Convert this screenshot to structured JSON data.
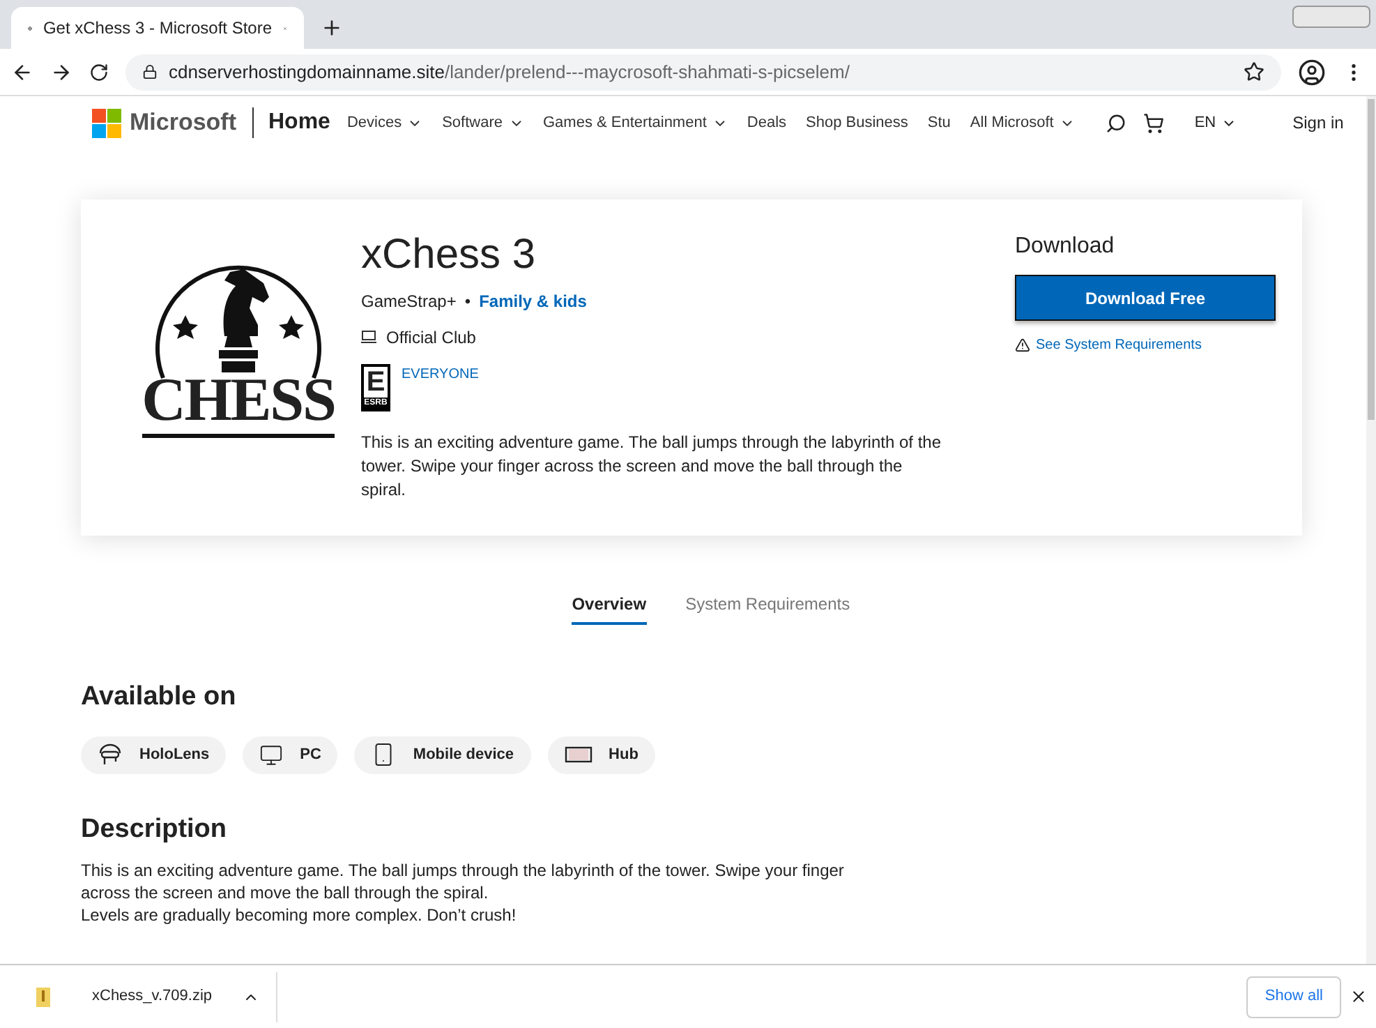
{
  "browser": {
    "tab_title": "Get xChess 3 - Microsoft Store",
    "url_host": "cdnserverhostingdomainname.site",
    "url_path": "/lander/prelend---maycrosoft-shahmati-s-picselem/"
  },
  "nav": {
    "brand": "Microsoft",
    "home": "Home",
    "items": [
      {
        "label": "Devices",
        "dropdown": true
      },
      {
        "label": "Software",
        "dropdown": true
      },
      {
        "label": "Games & Entertainment",
        "dropdown": true
      },
      {
        "label": "Deals",
        "dropdown": false
      },
      {
        "label": "Shop Business",
        "dropdown": false
      },
      {
        "label": "Stu",
        "dropdown": false
      },
      {
        "label": "All Microsoft",
        "dropdown": true
      }
    ],
    "language": "EN",
    "sign_in": "Sign in"
  },
  "product": {
    "logo_text": "CHESS",
    "title": "xChess 3",
    "publisher": "GameStrap+",
    "bullet": "•",
    "category": "Family & kids",
    "club": "Official Club",
    "rating_letter": "E",
    "rating_board": "ESRB",
    "rating": "EVERYONE",
    "summary": "This is an exciting adventure game. The ball jumps through the labyrinth of the tower. Swipe your finger across the screen and move the ball through the spiral."
  },
  "download": {
    "heading": "Download",
    "button": "Download Free",
    "requirements_link": "See System Requirements"
  },
  "tabs": [
    {
      "label": "Overview",
      "selected": true
    },
    {
      "label": "System Requirements",
      "selected": false
    }
  ],
  "available": {
    "heading": "Available on",
    "devices": [
      {
        "kind": "hololens",
        "label": "HoloLens"
      },
      {
        "kind": "pc",
        "label": "PC"
      },
      {
        "kind": "mobile",
        "label": "Mobile device"
      },
      {
        "kind": "hub",
        "label": "Hub"
      }
    ]
  },
  "description": {
    "heading": "Description",
    "paragraphs": [
      "This is an exciting adventure game. The ball jumps through the labyrinth of the tower. Swipe your finger across the screen and move the ball through the spiral.",
      "Levels are gradually becoming more complex. Don’t crush!"
    ]
  },
  "download_bar": {
    "file": "xChess_v.709.zip",
    "show_all": "Show all"
  }
}
